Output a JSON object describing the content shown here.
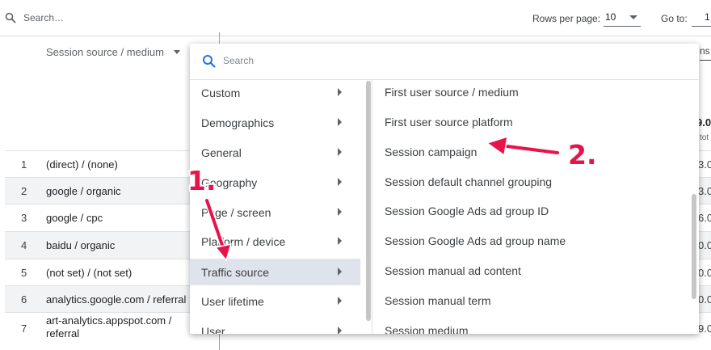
{
  "toolbar": {
    "search_placeholder": "Search…",
    "rows_per_page_label": "Rows per page:",
    "rows_per_page_value": "10",
    "go_to_label": "Go to:",
    "go_to_value": "1"
  },
  "table": {
    "column_header": "Session source / medium",
    "right_header_clip": "ns",
    "right_total_clip": "9.0",
    "right_total_sub": "tot",
    "rows": [
      {
        "index": "1",
        "source": "(direct) / (none)",
        "value_clip": "3.0"
      },
      {
        "index": "2",
        "source": "google / organic",
        "value_clip": "3.0"
      },
      {
        "index": "3",
        "source": "google / cpc",
        "value_clip": "6.0"
      },
      {
        "index": "4",
        "source": "baidu / organic",
        "value_clip": "0.0"
      },
      {
        "index": "5",
        "source": "(not set) / (not set)",
        "value_clip": "0.0"
      },
      {
        "index": "6",
        "source": "analytics.google.com / referral",
        "value_clip": "0.0"
      },
      {
        "index": "7",
        "source_line1": "art-analytics.appspot.com /",
        "source_line2": "referral",
        "value_clip": "9.0"
      }
    ]
  },
  "dropdown": {
    "search_placeholder": "Search",
    "categories": [
      {
        "label": "Custom"
      },
      {
        "label": "Demographics"
      },
      {
        "label": "General"
      },
      {
        "label": "Geography"
      },
      {
        "label": "Page / screen"
      },
      {
        "label": "Platform / device"
      },
      {
        "label": "Traffic source",
        "selected": true
      },
      {
        "label": "User lifetime"
      },
      {
        "label": "User"
      }
    ],
    "options": [
      "First user source / medium",
      "First user source platform",
      "Session campaign",
      "Session default channel grouping",
      "Session Google Ads ad group ID",
      "Session Google Ads ad group name",
      "Session manual ad content",
      "Session manual term",
      "Session medium"
    ]
  },
  "annotations": {
    "step1": "1.",
    "step2": "2.",
    "color": "#e8134a"
  },
  "icons": [
    "search-icon",
    "chevron-down-icon",
    "chevron-right-icon"
  ]
}
